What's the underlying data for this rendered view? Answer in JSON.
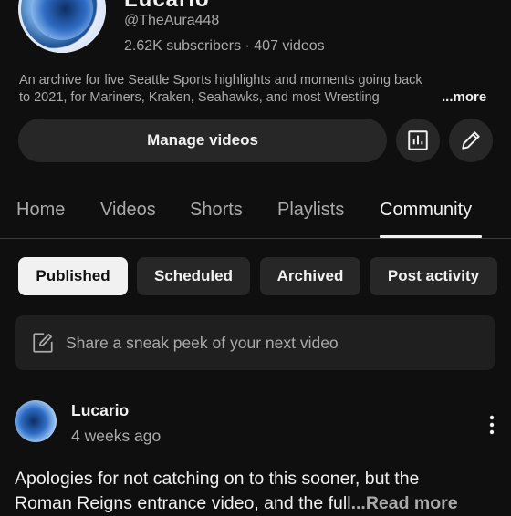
{
  "channel": {
    "title": "Lucario",
    "handle": "@TheAura448",
    "stats": "2.62K subscribers · 407 videos",
    "description_line1": "An archive for live Seattle Sports highlights and moments going back",
    "description_line2": "to 2021, for Mariners, Kraken, Seahawks, and most Wrestling",
    "more_label": "...more"
  },
  "actions": {
    "manage_label": "Manage videos",
    "analytics_icon": "analytics-icon",
    "edit_icon": "pencil-icon"
  },
  "tabs": [
    {
      "label": "Home"
    },
    {
      "label": "Videos"
    },
    {
      "label": "Shorts"
    },
    {
      "label": "Playlists"
    },
    {
      "label": "Community",
      "active": true
    }
  ],
  "chips": [
    {
      "label": "Published",
      "selected": true
    },
    {
      "label": "Scheduled"
    },
    {
      "label": "Archived"
    },
    {
      "label": "Post activity"
    }
  ],
  "composer": {
    "placeholder": "Share a sneak peek of your next video",
    "icon": "edit-note-icon"
  },
  "post": {
    "author": "Lucario",
    "time": "4 weeks ago",
    "body_line1": "Apologies for not catching on to this sooner, but the",
    "body_line2": "Roman Reigns entrance video, and the full",
    "read_more": "...Read more"
  },
  "colors": {
    "background": "#0f0f0f",
    "surface": "#272727",
    "text_primary": "#f1f1f1",
    "text_secondary": "#aaaaaa"
  }
}
